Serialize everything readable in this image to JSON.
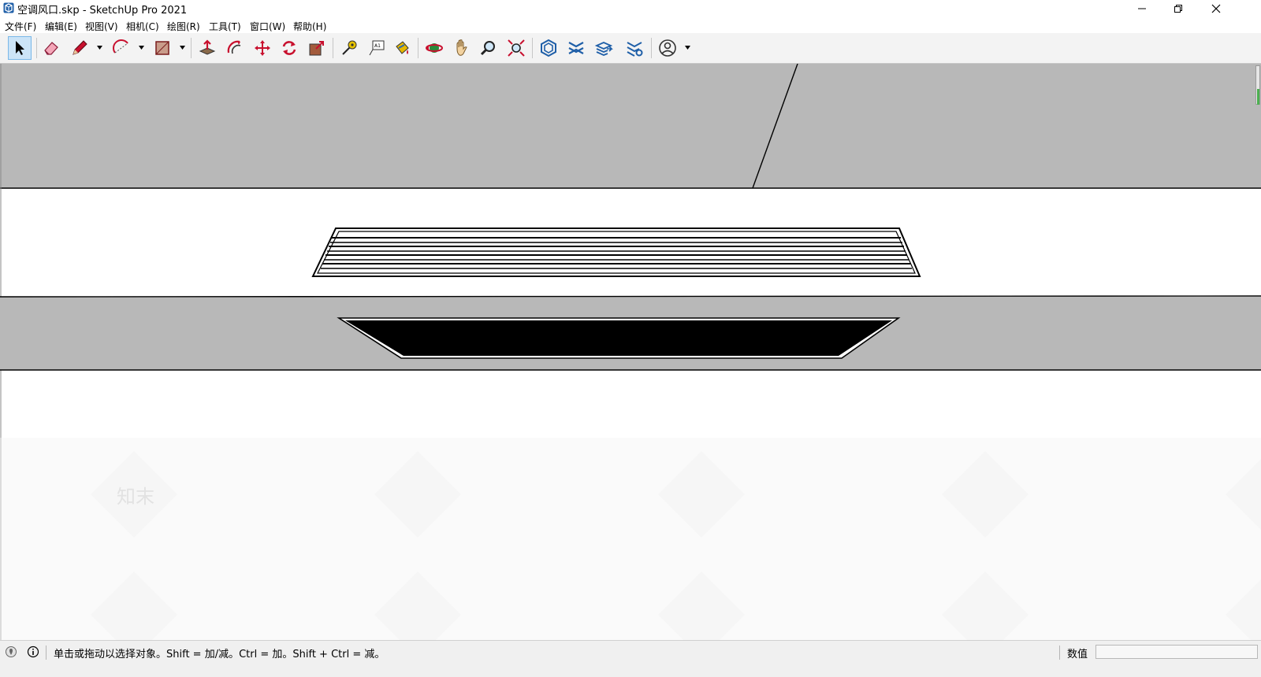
{
  "window": {
    "title": "空调风口.skp - SketchUp Pro 2021",
    "controls": [
      "minimize",
      "restore",
      "close"
    ]
  },
  "menu": {
    "items": [
      {
        "label": "文件(F)"
      },
      {
        "label": "编辑(E)"
      },
      {
        "label": "视图(V)"
      },
      {
        "label": "相机(C)"
      },
      {
        "label": "绘图(R)"
      },
      {
        "label": "工具(T)"
      },
      {
        "label": "窗口(W)"
      },
      {
        "label": "帮助(H)"
      }
    ]
  },
  "toolbar": {
    "tools": [
      {
        "name": "select-tool",
        "icon": "arrow-cursor-icon",
        "active": true
      },
      {
        "name": "eraser-tool",
        "icon": "eraser-icon"
      },
      {
        "name": "line-tool",
        "icon": "pencil-icon",
        "dropdown": true
      },
      {
        "name": "arc-tool",
        "icon": "arc-icon",
        "dropdown": true
      },
      {
        "name": "rectangle-tool",
        "icon": "rectangle-icon",
        "dropdown": true
      },
      {
        "name": "push-pull-tool",
        "icon": "push-pull-icon"
      },
      {
        "name": "offset-tool",
        "icon": "offset-icon"
      },
      {
        "name": "move-tool",
        "icon": "move-arrows-icon"
      },
      {
        "name": "rotate-tool",
        "icon": "rotate-icon"
      },
      {
        "name": "scale-tool",
        "icon": "scale-icon"
      },
      {
        "name": "tape-measure-tool",
        "icon": "tape-measure-icon"
      },
      {
        "name": "text-tool",
        "icon": "text-icon"
      },
      {
        "name": "paint-bucket-tool",
        "icon": "paint-bucket-icon"
      },
      {
        "name": "orbit-tool",
        "icon": "orbit-icon"
      },
      {
        "name": "pan-tool",
        "icon": "hand-icon"
      },
      {
        "name": "zoom-tool",
        "icon": "magnifier-icon"
      },
      {
        "name": "zoom-extents-tool",
        "icon": "zoom-extents-icon"
      },
      {
        "name": "3d-warehouse-tool",
        "icon": "warehouse-icon"
      },
      {
        "name": "extension-warehouse-tool",
        "icon": "extension-icon"
      },
      {
        "name": "layout-send-tool",
        "icon": "layers-send-icon"
      },
      {
        "name": "extension-manager-tool",
        "icon": "extension-manager-icon"
      },
      {
        "name": "account-menu",
        "icon": "user-account-icon",
        "dropdown": true
      }
    ]
  },
  "status": {
    "message": "单击或拖动以选择对象。Shift = 加/减。Ctrl = 加。Shift + Ctrl = 减。",
    "measurements_label": "数值",
    "measurements_value": ""
  },
  "watermark": {
    "text": "知末"
  },
  "colors": {
    "wall_gray": "#b8b8b8",
    "vent_fill": "#000000",
    "active_tool_bg": "#cce4f7"
  }
}
